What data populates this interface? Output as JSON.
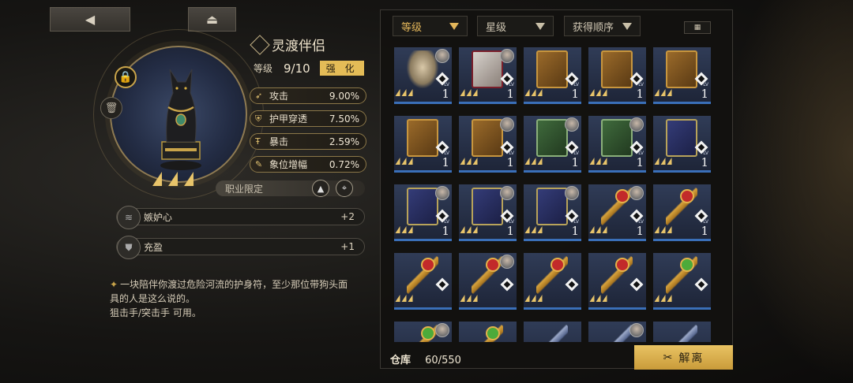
{
  "nav": {
    "back_icon": "back-arrow-icon",
    "menu_icon": "eject-icon"
  },
  "item": {
    "name": "灵渡伴侣",
    "level_label": "等级",
    "level_value": "9/10",
    "enhance_label": "强 化",
    "rarity_stars": 3,
    "stats": [
      {
        "icon": "attack-icon",
        "name": "攻击",
        "value": "9.00%"
      },
      {
        "icon": "armor-pierce-icon",
        "name": "护甲穿透",
        "value": "7.50%"
      },
      {
        "icon": "crit-icon",
        "name": "暴击",
        "value": "2.59%"
      },
      {
        "icon": "phase-boost-icon",
        "name": "象位增幅",
        "value": "0.72%"
      }
    ],
    "class_limit_label": "职业限定",
    "perks": [
      {
        "icon": "wings-icon",
        "name": "嫉妒心",
        "value": "+2"
      },
      {
        "icon": "shield-icon",
        "name": "充盈",
        "value": "+1"
      }
    ],
    "description": [
      "一块陪伴你渡过危险河流的护身符，至少那位带狗头面",
      "具的人是这么说的。",
      "狙击手/突击手 可用。"
    ]
  },
  "inventory": {
    "sort_options": [
      {
        "label": "等级",
        "active": true
      },
      {
        "label": "星级",
        "active": false
      },
      {
        "label": "获得顺序",
        "active": false
      }
    ],
    "lv_label": "LV",
    "items": [
      {
        "art": "figure",
        "level": "1",
        "avatar": true
      },
      {
        "art": "book-red",
        "level": "1",
        "avatar": true
      },
      {
        "art": "book-brown",
        "level": "1",
        "avatar": false
      },
      {
        "art": "book-brown",
        "level": "1",
        "avatar": false
      },
      {
        "art": "book-brown",
        "level": "1",
        "avatar": false
      },
      {
        "art": "book-brown",
        "level": "1",
        "avatar": false
      },
      {
        "art": "book-brown",
        "level": "1",
        "avatar": true
      },
      {
        "art": "book-green",
        "level": "1",
        "avatar": true
      },
      {
        "art": "book-green",
        "level": "1",
        "avatar": true
      },
      {
        "art": "book-blue",
        "level": "1",
        "avatar": false
      },
      {
        "art": "book-blue",
        "level": "1",
        "avatar": true
      },
      {
        "art": "book-blue",
        "level": "1",
        "avatar": true
      },
      {
        "art": "book-blue",
        "level": "1",
        "avatar": true
      },
      {
        "art": "key-red",
        "level": "1",
        "avatar": true
      },
      {
        "art": "key-red",
        "level": "1",
        "avatar": false
      },
      {
        "art": "key-red",
        "level": "",
        "avatar": false
      },
      {
        "art": "key-red",
        "level": "",
        "avatar": true
      },
      {
        "art": "key-red",
        "level": "",
        "avatar": false
      },
      {
        "art": "key-red",
        "level": "",
        "avatar": false
      },
      {
        "art": "key-green",
        "level": "",
        "avatar": false
      },
      {
        "art": "key-green",
        "level": "",
        "avatar": true
      },
      {
        "art": "key-green",
        "level": "",
        "avatar": false
      },
      {
        "art": "key-blue",
        "level": "",
        "avatar": false
      },
      {
        "art": "key-blue",
        "level": "",
        "avatar": true
      },
      {
        "art": "key-blue",
        "level": "",
        "avatar": false
      }
    ],
    "storage_label": "仓库",
    "storage_count": "60/550",
    "release_label": "解离"
  }
}
